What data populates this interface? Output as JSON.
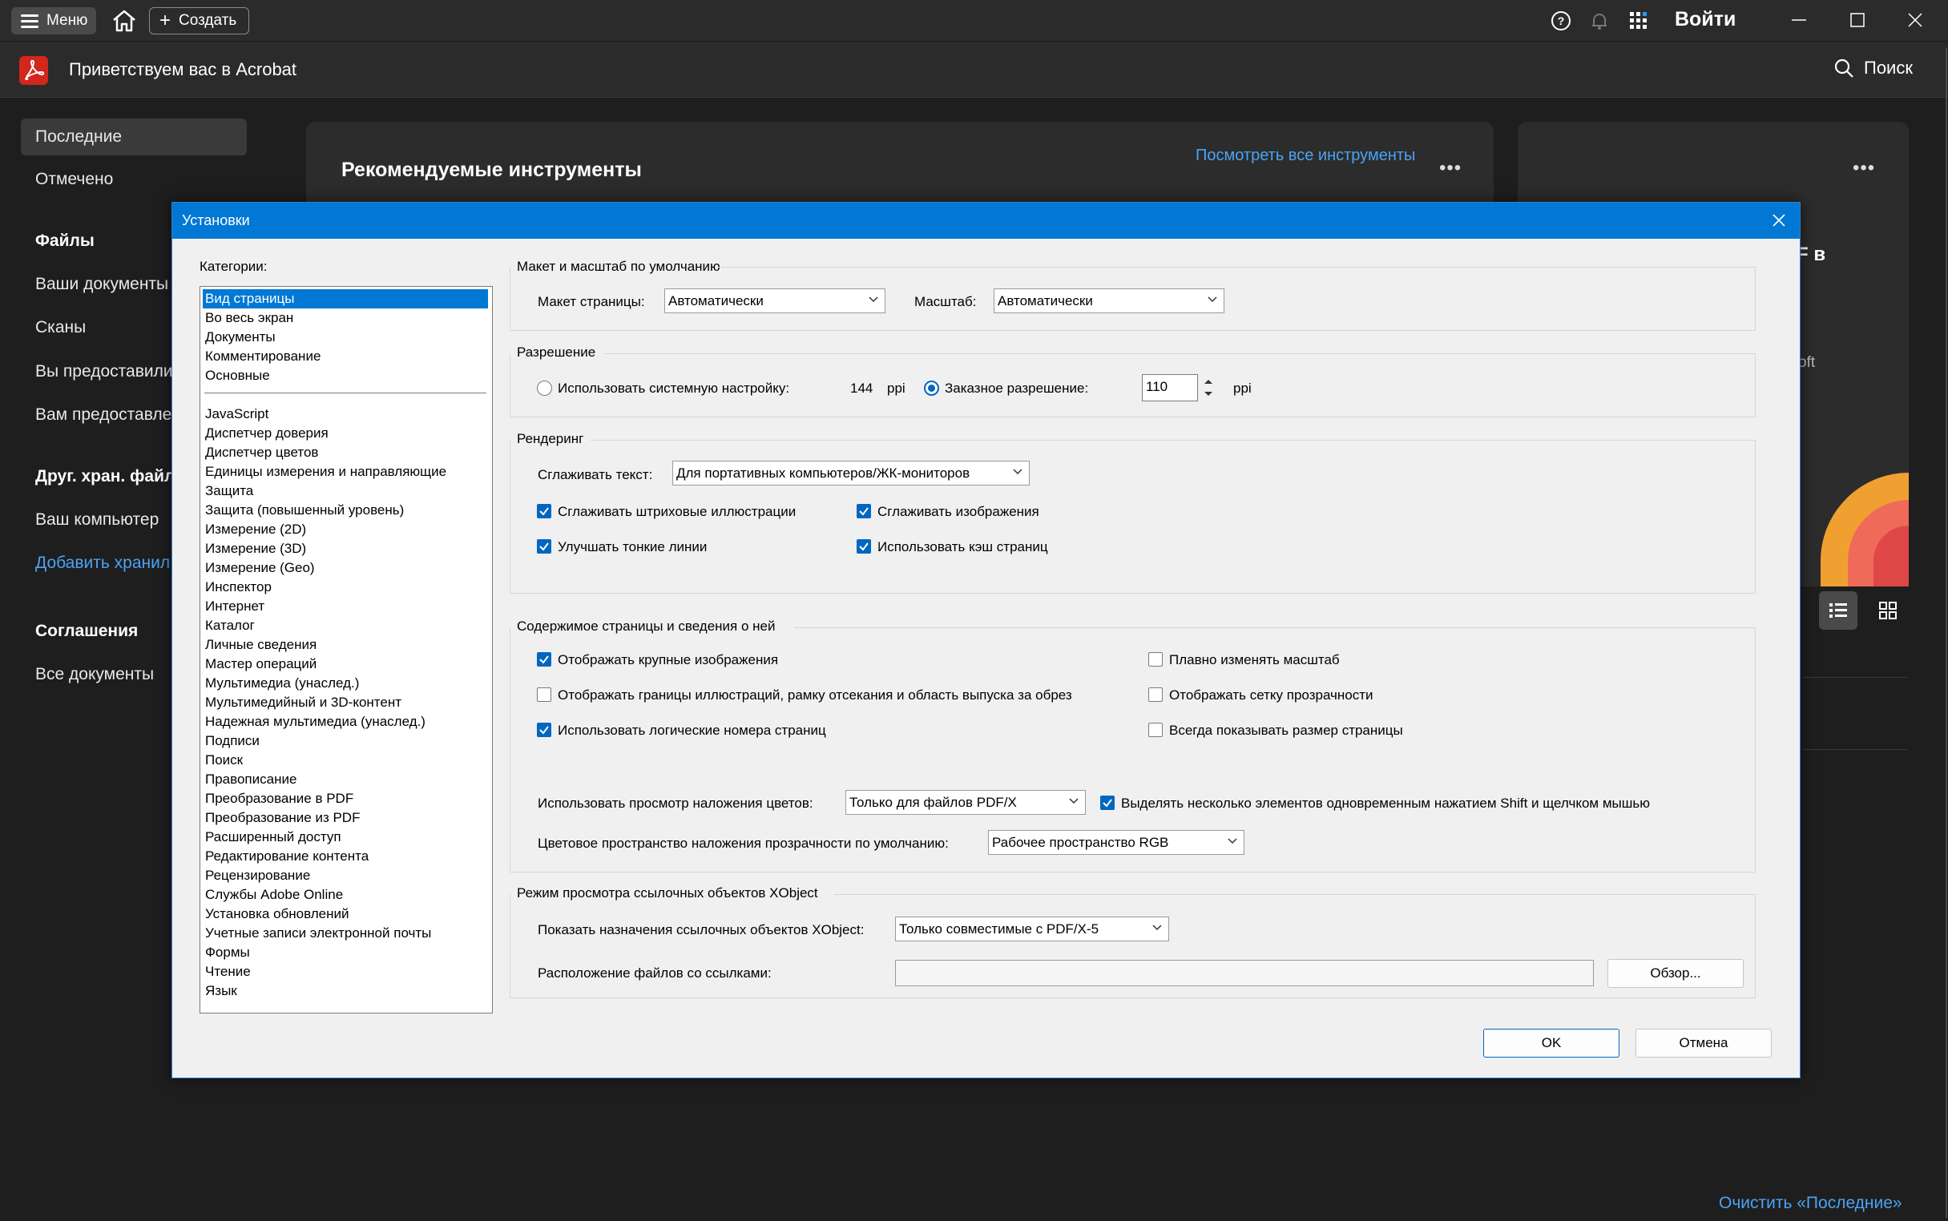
{
  "titlebar": {
    "menu_label": "Меню",
    "create_label": "Создать",
    "signin_label": "Войти"
  },
  "app": {
    "title": "Приветствуем вас в Acrobat",
    "search_label": "Поиск"
  },
  "nav": {
    "recent": "Последние",
    "starred": "Отмечено",
    "files_header": "Файлы",
    "your_documents": "Ваши документы",
    "scans": "Сканы",
    "shared_by_you": "Вы предоставили",
    "shared_with_you": "Вам предоставле",
    "other_storage_header": "Друг. хран. файл",
    "your_computer": "Ваш компьютер",
    "add_storage": "Добавить хранил",
    "agreements_header": "Соглашения",
    "all_documents": "Все документы"
  },
  "main": {
    "recommended_title": "Рекомендуемые инструменты",
    "view_all_tools": "Посмотреть все инструменты",
    "right_card_partial_1": "F в",
    "right_card_partial_2": "oft",
    "clear_recent": "Очистить «Последние»"
  },
  "dialog": {
    "title": "Установки",
    "categories_label": "Категории:",
    "categories_top": [
      "Вид страницы",
      "Во весь экран",
      "Документы",
      "Комментирование",
      "Основные"
    ],
    "categories_bottom": [
      "JavaScript",
      "Диспетчер доверия",
      "Диспетчер цветов",
      "Единицы измерения и направляющие",
      "Защита",
      "Защита (повышенный уровень)",
      "Измерение (2D)",
      "Измерение (3D)",
      "Измерение (Geo)",
      "Инспектор",
      "Интернет",
      "Каталог",
      "Личные сведения",
      "Мастер операций",
      "Мультимедиа (унаслед.)",
      "Мультимедийный и 3D-контент",
      "Надежная мультимедиа (унаслед.)",
      "Подписи",
      "Поиск",
      "Правописание",
      "Преобразование в PDF",
      "Преобразование из PDF",
      "Расширенный доступ",
      "Редактирование контента",
      "Рецензирование",
      "Службы Adobe Online",
      "Установка обновлений",
      "Учетные записи электронной почты",
      "Формы",
      "Чтение",
      "Язык"
    ],
    "selected_category": "Вид страницы",
    "layout": {
      "group_title": "Макет и масштаб по умолчанию",
      "page_layout_label": "Макет страницы:",
      "page_layout_value": "Автоматически",
      "zoom_label": "Масштаб:",
      "zoom_value": "Автоматически"
    },
    "resolution": {
      "group_title": "Разрешение",
      "system_label": "Использовать системную настройку:",
      "system_value": "144",
      "system_unit": "ppi",
      "custom_label": "Заказное разрешение:",
      "custom_value": "110",
      "custom_unit": "ppi",
      "custom_selected": true
    },
    "rendering": {
      "group_title": "Рендеринг",
      "smooth_text_label": "Сглаживать текст:",
      "smooth_text_value": "Для портативных компьютеров/ЖК-мониторов",
      "smooth_line_art": "Сглаживать штриховые иллюстрации",
      "smooth_images": "Сглаживать изображения",
      "enhance_thin_lines": "Улучшать тонкие линии",
      "use_page_cache": "Использовать кэш страниц"
    },
    "content": {
      "group_title": "Содержимое страницы и сведения о ней",
      "show_large_images": "Отображать крупные изображения",
      "smooth_zoom": "Плавно изменять масштаб",
      "show_art_trim_bleed": "Отображать границы иллюстраций, рамку отсекания и область выпуска за обрез",
      "show_transparency_grid": "Отображать сетку прозрачности",
      "use_logical_page_numbers": "Использовать логические номера страниц",
      "always_show_page_size": "Всегда показывать размер страницы",
      "overprint_label": "Использовать просмотр наложения цветов:",
      "overprint_value": "Только для файлов PDF/X",
      "shift_click_label": "Выделять несколько элементов одновременным нажатием Shift и щелчком мышью",
      "blend_space_label": "Цветовое пространство наложения прозрачности по умолчанию:",
      "blend_space_value": "Рабочее пространство RGB"
    },
    "xobject": {
      "group_title": "Режим просмотра ссылочных объектов XObject",
      "show_targets_label": "Показать назначения ссылочных объектов XObject:",
      "show_targets_value": "Только совместимые с PDF/X-5",
      "location_label": "Расположение файлов со ссылками:",
      "location_value": "",
      "browse_label": "Обзор..."
    },
    "ok_label": "OK",
    "cancel_label": "Отмена"
  }
}
